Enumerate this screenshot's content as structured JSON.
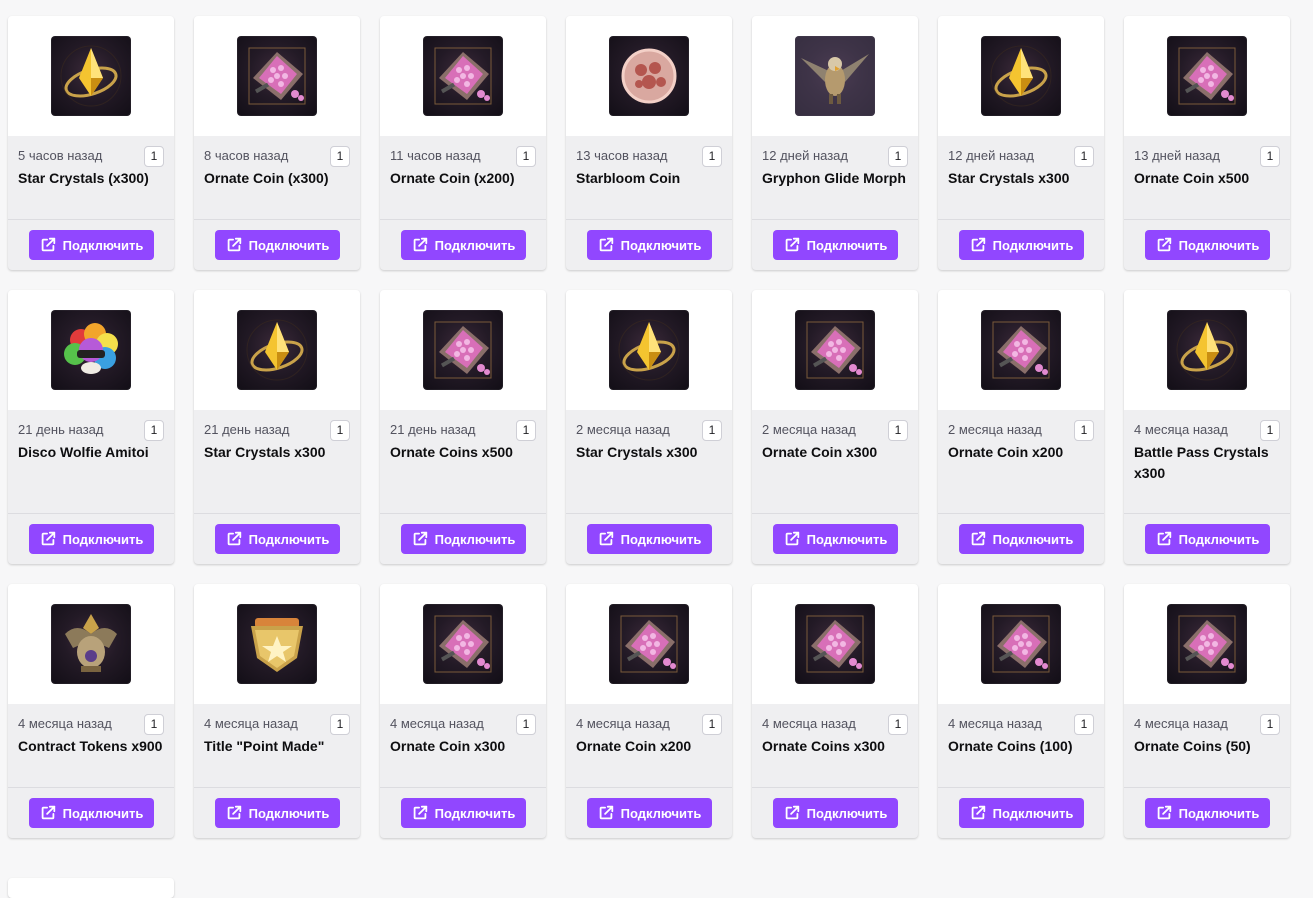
{
  "connect_label": "Подключить",
  "colors": {
    "accent": "#9147ff",
    "card_bg": "#efeff1",
    "page_bg": "#f7f7f8"
  },
  "items": [
    {
      "time": "5 часов назад",
      "qty": "1",
      "name": "Star Crystals (x300)",
      "icon": "star-crystal-icon"
    },
    {
      "time": "8 часов назад",
      "qty": "1",
      "name": "Ornate Coin (x300)",
      "icon": "ornate-coin-chest-icon"
    },
    {
      "time": "11 часов назад",
      "qty": "1",
      "name": "Ornate Coin (x200)",
      "icon": "ornate-coin-chest-icon"
    },
    {
      "time": "13 часов назад",
      "qty": "1",
      "name": "Starbloom Coin",
      "icon": "starbloom-coin-icon"
    },
    {
      "time": "12 дней назад",
      "qty": "1",
      "name": "Gryphon Glide Morph",
      "icon": "gryphon-icon"
    },
    {
      "time": "12 дней назад",
      "qty": "1",
      "name": "Star Crystals x300",
      "icon": "star-crystal-icon"
    },
    {
      "time": "13 дней назад",
      "qty": "1",
      "name": "Ornate Coin x500",
      "icon": "ornate-coin-chest-icon"
    },
    {
      "time": "21 день назад",
      "qty": "1",
      "name": "Disco Wolfie Amitoi",
      "icon": "disco-wolfie-icon"
    },
    {
      "time": "21 день назад",
      "qty": "1",
      "name": "Star Crystals x300",
      "icon": "star-crystal-icon"
    },
    {
      "time": "21 день назад",
      "qty": "1",
      "name": "Ornate Coins x500",
      "icon": "ornate-coin-chest-icon"
    },
    {
      "time": "2 месяца назад",
      "qty": "1",
      "name": "Star Crystals x300",
      "icon": "star-crystal-icon"
    },
    {
      "time": "2 месяца назад",
      "qty": "1",
      "name": "Ornate Coin x300",
      "icon": "ornate-coin-chest-icon"
    },
    {
      "time": "2 месяца назад",
      "qty": "1",
      "name": "Ornate Coin x200",
      "icon": "ornate-coin-chest-icon"
    },
    {
      "time": "4 месяца назад",
      "qty": "1",
      "name": "Battle Pass Crystals x300",
      "icon": "star-crystal-icon"
    },
    {
      "time": "4 месяца назад",
      "qty": "1",
      "name": "Contract Tokens x900",
      "icon": "contract-token-icon"
    },
    {
      "time": "4 месяца назад",
      "qty": "1",
      "name": "Title \"Point Made\"",
      "icon": "title-emblem-icon"
    },
    {
      "time": "4 месяца назад",
      "qty": "1",
      "name": "Ornate Coin x300",
      "icon": "ornate-coin-chest-icon"
    },
    {
      "time": "4 месяца назад",
      "qty": "1",
      "name": "Ornate Coin x200",
      "icon": "ornate-coin-chest-icon"
    },
    {
      "time": "4 месяца назад",
      "qty": "1",
      "name": "Ornate Coins x300",
      "icon": "ornate-coin-chest-icon"
    },
    {
      "time": "4 месяца назад",
      "qty": "1",
      "name": "Ornate Coins (100)",
      "icon": "ornate-coin-chest-icon"
    },
    {
      "time": "4 месяца назад",
      "qty": "1",
      "name": "Ornate Coins (50)",
      "icon": "ornate-coin-chest-icon"
    }
  ]
}
